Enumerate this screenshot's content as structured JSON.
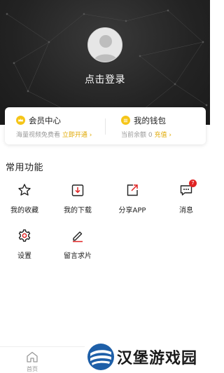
{
  "header": {
    "login_text": "点击登录"
  },
  "card": {
    "vip": {
      "title": "会员中心",
      "subtitle": "海量视频免费看",
      "action": "立即开通 ›"
    },
    "wallet": {
      "title": "我的钱包",
      "subtitle": "当前余额 0",
      "action": "充值 ›"
    }
  },
  "section": {
    "title": "常用功能"
  },
  "features": [
    {
      "label": "我的收藏",
      "icon": "star-icon"
    },
    {
      "label": "我的下载",
      "icon": "download-icon"
    },
    {
      "label": "分享APP",
      "icon": "share-icon"
    },
    {
      "label": "消息",
      "icon": "message-icon",
      "badge": "7"
    },
    {
      "label": "设置",
      "icon": "gear-icon"
    },
    {
      "label": "留言求片",
      "icon": "edit-icon"
    }
  ],
  "bottom_nav": {
    "home_label": "首页"
  },
  "watermark": {
    "text": "汉堡游戏园"
  },
  "colors": {
    "accent": "#f5c518",
    "badge": "#e02424",
    "header_bg": "#232323"
  }
}
